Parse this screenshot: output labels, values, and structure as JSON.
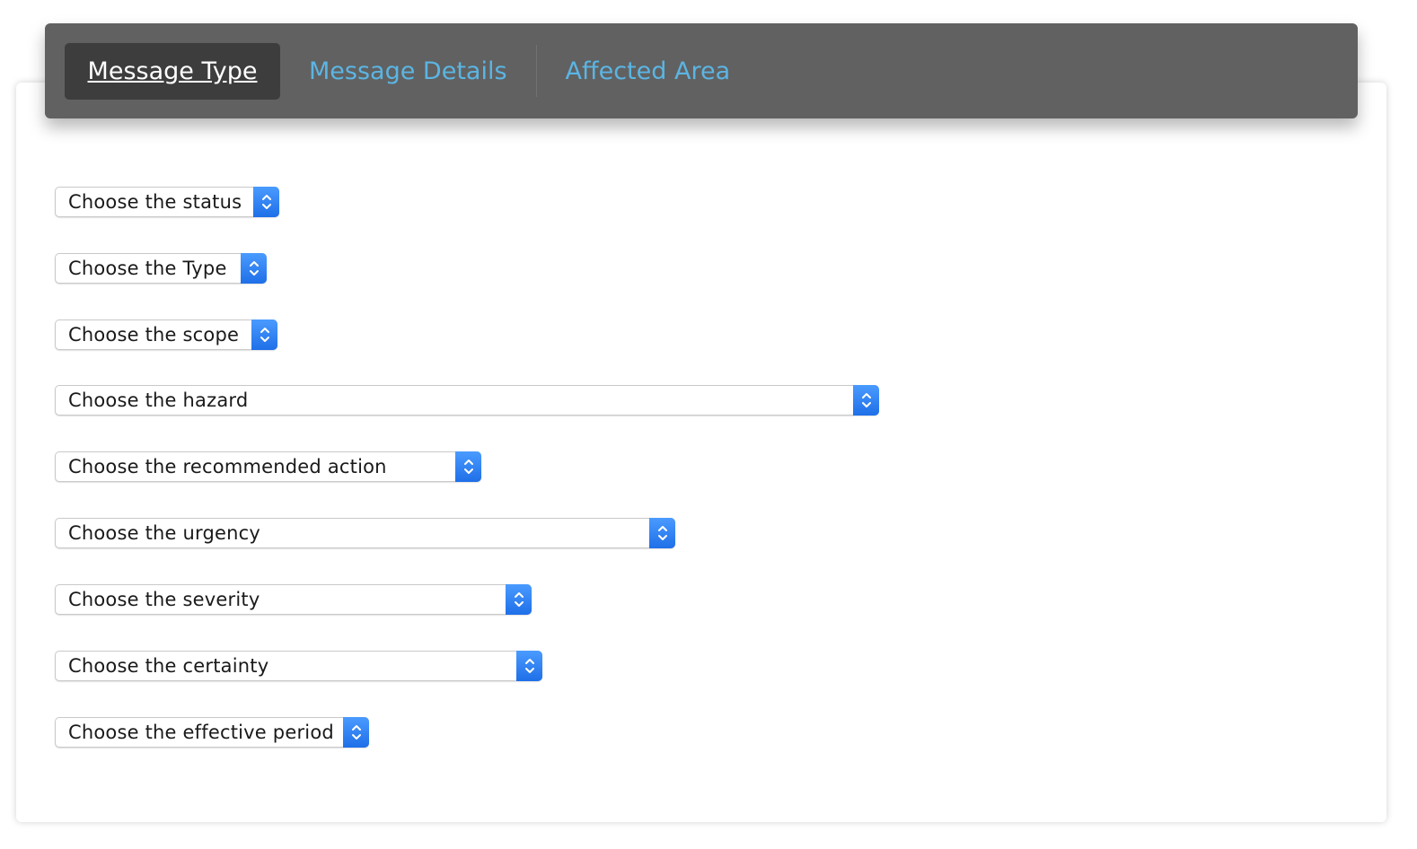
{
  "tabs": [
    {
      "label": "Message Type",
      "active": true
    },
    {
      "label": "Message Details",
      "active": false
    },
    {
      "label": "Affected Area",
      "active": false
    }
  ],
  "form": {
    "selects": [
      {
        "name": "status",
        "value": "Choose the status"
      },
      {
        "name": "type",
        "value": "Choose the Type"
      },
      {
        "name": "scope",
        "value": "Choose the scope"
      },
      {
        "name": "hazard",
        "value": "Choose the hazard"
      },
      {
        "name": "recommended-action",
        "value": "Choose the recommended action"
      },
      {
        "name": "urgency",
        "value": "Choose the urgency"
      },
      {
        "name": "severity",
        "value": "Choose the severity"
      },
      {
        "name": "certainty",
        "value": "Choose the certainty"
      },
      {
        "name": "effective-period",
        "value": "Choose the effective period"
      }
    ]
  },
  "colors": {
    "tabbar_bg": "#616161",
    "active_tab_bg": "#3d3d3d",
    "inactive_tab_text": "#5bb5e3",
    "stepper_blue": "#2a7cf0"
  },
  "icons": {
    "stepper": "chevron-up-down-icon"
  }
}
